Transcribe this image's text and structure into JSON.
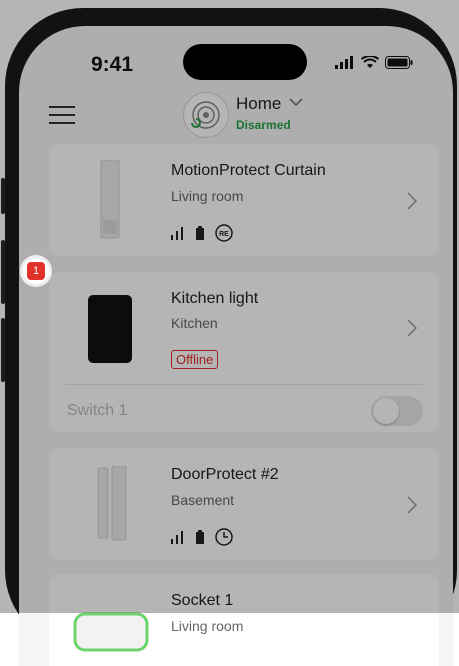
{
  "status_bar": {
    "time": "9:41"
  },
  "header": {
    "hub_name": "Home",
    "hub_status": "Disarmed"
  },
  "devices": [
    {
      "name": "MotionProtect Curtain",
      "room": "Living room"
    },
    {
      "name": "Kitchen light",
      "room": "Kitchen",
      "badge": "Offline",
      "alert_count": "1",
      "switch_label": "Switch 1"
    },
    {
      "name": "DoorProtect #2",
      "room": "Basement"
    },
    {
      "name": "Socket 1",
      "room": "Living room"
    }
  ],
  "colors": {
    "disarmed_green": "#24a148",
    "offline_red": "#e0312b",
    "screen_bg": "#f5f5f5"
  },
  "icons": [
    "menu-icon",
    "hub-logo-icon",
    "chevron-down-icon",
    "chevron-right-icon",
    "signal-icon",
    "battery-icon",
    "re-icon",
    "clock-icon",
    "wifi-icon"
  ]
}
